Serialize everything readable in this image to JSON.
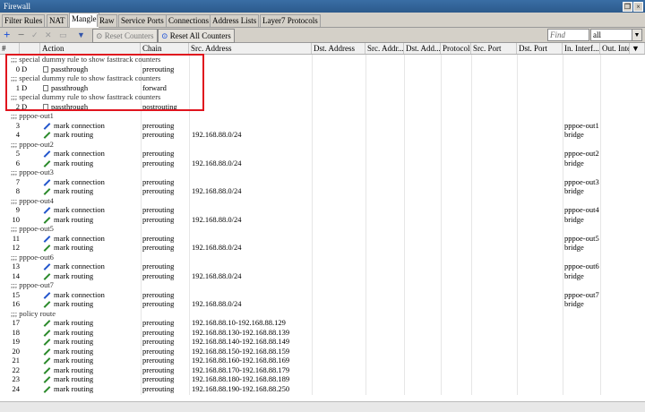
{
  "window": {
    "title": "Firewall"
  },
  "tabs": [
    "Filter Rules",
    "NAT",
    "Mangle",
    "Raw",
    "Service Ports",
    "Connections",
    "Address Lists",
    "Layer7 Protocols"
  ],
  "toolbar": {
    "reset_counters": "Reset Counters",
    "reset_all_counters": "Reset All Counters",
    "find_placeholder": "Find",
    "filter_value": "all"
  },
  "columns": [
    "#",
    "Action",
    "Chain",
    "Src. Address",
    "Dst. Address",
    "Src. Addr...",
    "Dst. Add...",
    "Protocol",
    "Src. Port",
    "Dst. Port",
    "In. Interf...",
    "Out. Inte..."
  ],
  "rows": [
    {
      "type": "comment",
      "text": ";;; special dummy rule to show fasttrack counters"
    },
    {
      "type": "rule",
      "num": "0",
      "flag": "D",
      "icon": "doc",
      "action": "passthrough",
      "chain": "prerouting",
      "src": "",
      "in": ""
    },
    {
      "type": "comment",
      "text": ";;; special dummy rule to show fasttrack counters"
    },
    {
      "type": "rule",
      "num": "1",
      "flag": "D",
      "icon": "doc",
      "action": "passthrough",
      "chain": "forward",
      "src": "",
      "in": ""
    },
    {
      "type": "comment",
      "text": ";;; special dummy rule to show fasttrack counters"
    },
    {
      "type": "rule",
      "num": "2",
      "flag": "D",
      "icon": "doc",
      "action": "passthrough",
      "chain": "postrouting",
      "src": "",
      "in": ""
    },
    {
      "type": "comment",
      "text": ";;; pppoe-out1"
    },
    {
      "type": "rule",
      "num": "3",
      "flag": "",
      "icon": "blue",
      "action": "mark connection",
      "chain": "prerouting",
      "src": "",
      "in": "pppoe-out1"
    },
    {
      "type": "rule",
      "num": "4",
      "flag": "",
      "icon": "green",
      "action": "mark routing",
      "chain": "prerouting",
      "src": "192.168.88.0/24",
      "in": "bridge"
    },
    {
      "type": "comment",
      "text": ";;; pppoe-out2"
    },
    {
      "type": "rule",
      "num": "5",
      "flag": "",
      "icon": "blue",
      "action": "mark connection",
      "chain": "prerouting",
      "src": "",
      "in": "pppoe-out2"
    },
    {
      "type": "rule",
      "num": "6",
      "flag": "",
      "icon": "green",
      "action": "mark routing",
      "chain": "prerouting",
      "src": "192.168.88.0/24",
      "in": "bridge"
    },
    {
      "type": "comment",
      "text": ";;; pppoe-out3"
    },
    {
      "type": "rule",
      "num": "7",
      "flag": "",
      "icon": "blue",
      "action": "mark connection",
      "chain": "prerouting",
      "src": "",
      "in": "pppoe-out3"
    },
    {
      "type": "rule",
      "num": "8",
      "flag": "",
      "icon": "green",
      "action": "mark routing",
      "chain": "prerouting",
      "src": "192.168.88.0/24",
      "in": "bridge"
    },
    {
      "type": "comment",
      "text": ";;; pppoe-out4"
    },
    {
      "type": "rule",
      "num": "9",
      "flag": "",
      "icon": "blue",
      "action": "mark connection",
      "chain": "prerouting",
      "src": "",
      "in": "pppoe-out4"
    },
    {
      "type": "rule",
      "num": "10",
      "flag": "",
      "icon": "green",
      "action": "mark routing",
      "chain": "prerouting",
      "src": "192.168.88.0/24",
      "in": "bridge"
    },
    {
      "type": "comment",
      "text": ";;; pppoe-out5"
    },
    {
      "type": "rule",
      "num": "11",
      "flag": "",
      "icon": "blue",
      "action": "mark connection",
      "chain": "prerouting",
      "src": "",
      "in": "pppoe-out5"
    },
    {
      "type": "rule",
      "num": "12",
      "flag": "",
      "icon": "green",
      "action": "mark routing",
      "chain": "prerouting",
      "src": "192.168.88.0/24",
      "in": "bridge"
    },
    {
      "type": "comment",
      "text": ";;; pppoe-out6"
    },
    {
      "type": "rule",
      "num": "13",
      "flag": "",
      "icon": "blue",
      "action": "mark connection",
      "chain": "prerouting",
      "src": "",
      "in": "pppoe-out6"
    },
    {
      "type": "rule",
      "num": "14",
      "flag": "",
      "icon": "green",
      "action": "mark routing",
      "chain": "prerouting",
      "src": "192.168.88.0/24",
      "in": "bridge"
    },
    {
      "type": "comment",
      "text": ";;; pppoe-out7"
    },
    {
      "type": "rule",
      "num": "15",
      "flag": "",
      "icon": "blue",
      "action": "mark connection",
      "chain": "prerouting",
      "src": "",
      "in": "pppoe-out7"
    },
    {
      "type": "rule",
      "num": "16",
      "flag": "",
      "icon": "green",
      "action": "mark routing",
      "chain": "prerouting",
      "src": "192.168.88.0/24",
      "in": "bridge"
    },
    {
      "type": "comment",
      "text": ";;; policy route"
    },
    {
      "type": "rule",
      "num": "17",
      "flag": "",
      "icon": "green",
      "action": "mark routing",
      "chain": "prerouting",
      "src": "192.168.88.10-192.168.88.129",
      "in": ""
    },
    {
      "type": "rule",
      "num": "18",
      "flag": "",
      "icon": "green",
      "action": "mark routing",
      "chain": "prerouting",
      "src": "192.168.88.130-192.168.88.139",
      "in": ""
    },
    {
      "type": "rule",
      "num": "19",
      "flag": "",
      "icon": "green",
      "action": "mark routing",
      "chain": "prerouting",
      "src": "192.168.88.140-192.168.88.149",
      "in": ""
    },
    {
      "type": "rule",
      "num": "20",
      "flag": "",
      "icon": "green",
      "action": "mark routing",
      "chain": "prerouting",
      "src": "192.168.88.150-192.168.88.159",
      "in": ""
    },
    {
      "type": "rule",
      "num": "21",
      "flag": "",
      "icon": "green",
      "action": "mark routing",
      "chain": "prerouting",
      "src": "192.168.88.160-192.168.88.169",
      "in": ""
    },
    {
      "type": "rule",
      "num": "22",
      "flag": "",
      "icon": "green",
      "action": "mark routing",
      "chain": "prerouting",
      "src": "192.168.88.170-192.168.88.179",
      "in": ""
    },
    {
      "type": "rule",
      "num": "23",
      "flag": "",
      "icon": "green",
      "action": "mark routing",
      "chain": "prerouting",
      "src": "192.168.88.180-192.168.88.189",
      "in": ""
    },
    {
      "type": "rule",
      "num": "24",
      "flag": "",
      "icon": "green",
      "action": "mark routing",
      "chain": "prerouting",
      "src": "192.168.88.190-192.168.88.250",
      "in": ""
    }
  ]
}
